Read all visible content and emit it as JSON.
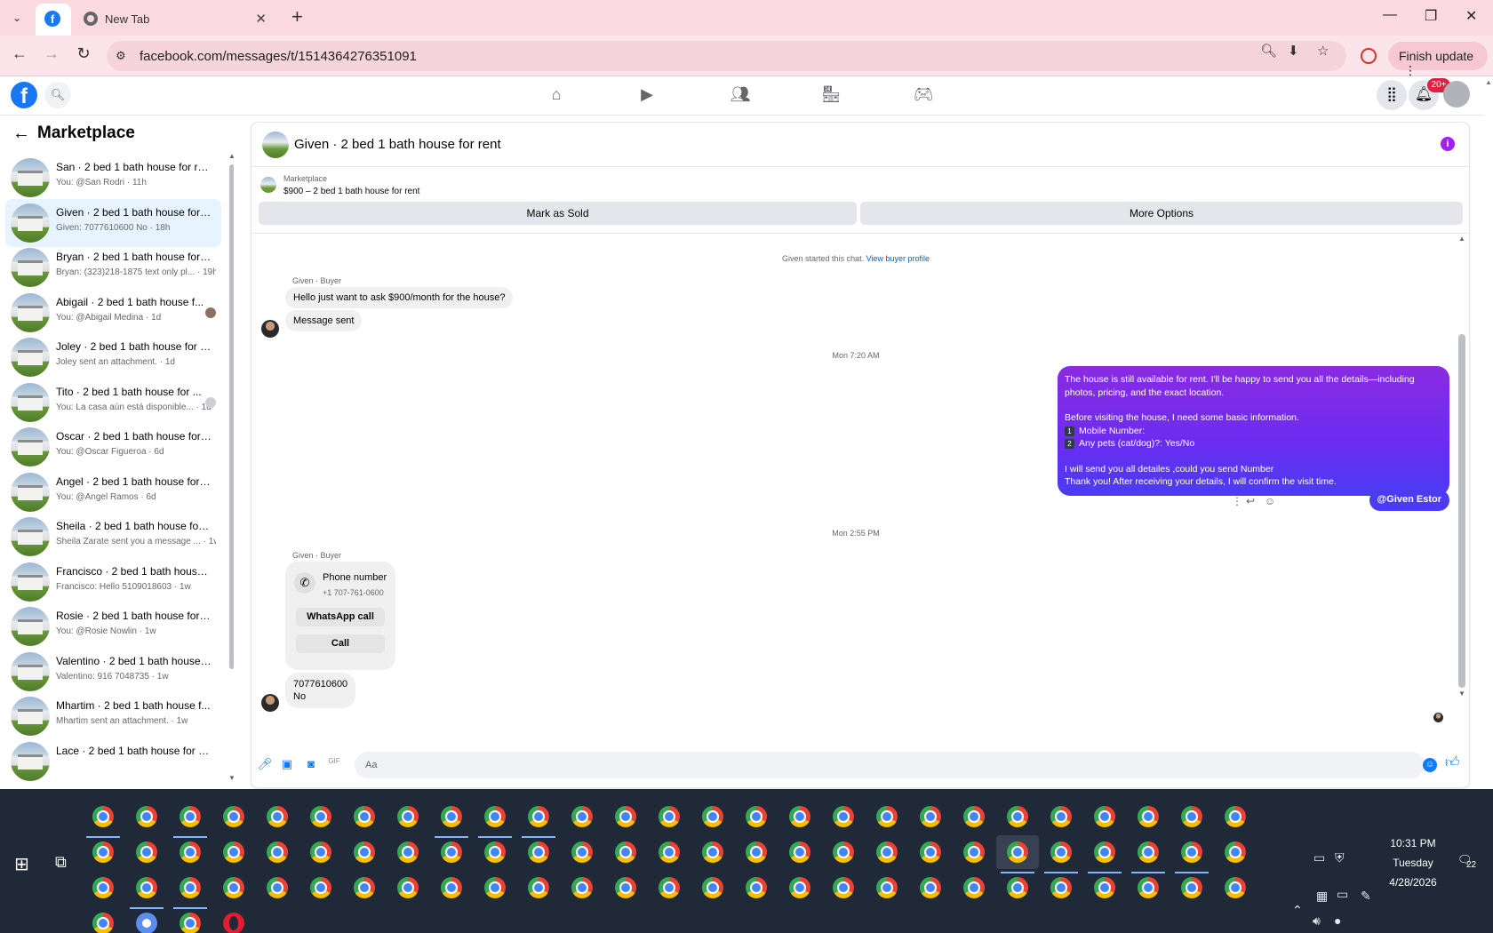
{
  "browser": {
    "tabs": [
      {
        "label": ""
      },
      {
        "label": "New Tab"
      }
    ],
    "url": "facebook.com/messages/t/1514364276351091",
    "finish_update_label": "Finish update"
  },
  "fb_header": {
    "logo": "f",
    "notification_badge": "20+"
  },
  "sidebar": {
    "title": "Marketplace",
    "conversations": [
      {
        "name": "San · 2 bed 1 bath house for rent",
        "sub": "You: @San Rodri · 11h",
        "selected": false,
        "read": ""
      },
      {
        "name": "Given · 2 bed 1 bath house for r...",
        "sub": "Given: 7077610600 No · 18h",
        "selected": true,
        "read": ""
      },
      {
        "name": "Bryan · 2 bed 1 bath house for r...",
        "sub": "Bryan: (323)218-1875 text only pl... · 19h",
        "selected": false,
        "read": ""
      },
      {
        "name": "Abigail · 2 bed 1 bath house f...",
        "sub": "You: @Abigail Medina · 1d",
        "selected": false,
        "read": "photo"
      },
      {
        "name": "Joley · 2 bed 1 bath house for r...",
        "sub": "Joley sent an attachment. · 1d",
        "selected": false,
        "read": ""
      },
      {
        "name": "Tito · 2 bed 1 bath house for ...",
        "sub": "You: La casa aún está disponible... · 1d",
        "selected": false,
        "read": "grey"
      },
      {
        "name": "Oscar · 2 bed 1 bath house for r...",
        "sub": "You: @Oscar Figueroa · 6d",
        "selected": false,
        "read": ""
      },
      {
        "name": "Angel · 2 bed 1 bath house for r...",
        "sub": "You: @Angel Ramos · 6d",
        "selected": false,
        "read": ""
      },
      {
        "name": "Sheila · 2 bed 1 bath house for r...",
        "sub": "Sheila Zarate sent you a message ... · 1w",
        "selected": false,
        "read": ""
      },
      {
        "name": "Francisco · 2 bed 1 bath house f...",
        "sub": "Francisco: Hello 5109018603 · 1w",
        "selected": false,
        "read": ""
      },
      {
        "name": "Rosie · 2 bed 1 bath house for r...",
        "sub": "You: @Rosie Nowlin · 1w",
        "selected": false,
        "read": ""
      },
      {
        "name": "Valentino · 2 bed 1 bath house f...",
        "sub": "Valentino: 916 7048735 · 1w",
        "selected": false,
        "read": ""
      },
      {
        "name": "Mhartim · 2 bed 1 bath house f...",
        "sub": "Mhartim sent an attachment. · 1w",
        "selected": false,
        "read": ""
      },
      {
        "name": "Lace · 2 bed 1 bath house for rent",
        "sub": "",
        "selected": false,
        "read": ""
      }
    ]
  },
  "chat": {
    "title": "Given · 2 bed 1 bath house for rent",
    "marketplace_label": "Marketplace",
    "listing": "$900 – 2 bed 1 bath house for rent",
    "mark_sold_label": "Mark as Sold",
    "more_options_label": "More Options",
    "started_text": "Given started this chat.",
    "view_profile_label": "View buyer profile",
    "sender_label": "Given · Buyer",
    "msg1": "Hello just want to ask $900/month for the house?",
    "msg2": "Message sent",
    "time1": "Mon 7:20 AM",
    "out_lines": {
      "l1": "The house is still available for rent. I'll be happy to send you all the details—including",
      "l2": "photos, pricing, and the exact location.",
      "l3": "Before visiting the house, I need some basic information.",
      "n1": "1",
      "l4": "Mobile Number:",
      "n2": "2",
      "l5": "Any pets (cat/dog)?: Yes/No",
      "l6": "I will send you all detailes ,could you send Number",
      "l7": "Thank you! After receiving your details, I will confirm the visit time."
    },
    "mention": "@Given Estor",
    "time2": "Mon 2:55 PM",
    "sender_label2": "Given · Buyer",
    "phone_title": "Phone number",
    "phone_number": "+1 707-761-0600",
    "whatsapp_label": "WhatsApp call",
    "call_label": "Call",
    "reply_line1": "7077610600",
    "reply_line2": "No",
    "composer_placeholder": "Aa"
  },
  "taskbar": {
    "time": "10:31 PM",
    "day": "Tuesday",
    "date": "4/28/2026",
    "notification_count": "22"
  }
}
